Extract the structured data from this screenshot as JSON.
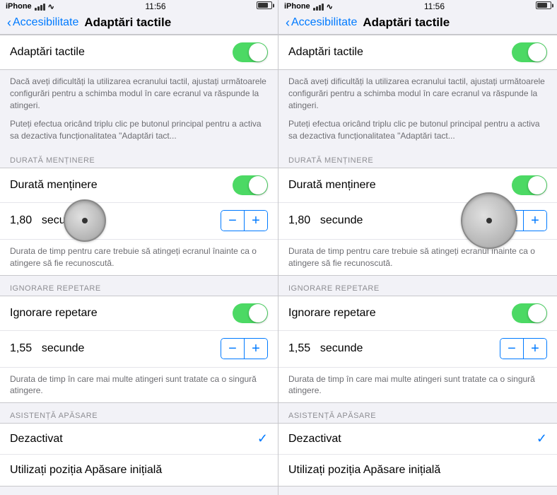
{
  "panels": [
    {
      "id": "left",
      "statusBar": {
        "carrier": "iPhone",
        "time": "11:56",
        "battery": true
      },
      "nav": {
        "backLabel": "Accesibilitate",
        "title": "Adaptări tactile"
      },
      "mainToggle": {
        "label": "Adaptări tactile",
        "on": true
      },
      "description1": "Dacă aveți dificultăți la utilizarea ecranului tactil, ajustați următoarele configurări pentru a schimba modul în care ecranul va răspunde la atingeri.",
      "description2": "Puteți efectua oricând triplu clic pe butonul principal pentru a activa sa dezactiva funcționalitatea \"Adaptări tact...",
      "sections": [
        {
          "header": "DURATĂ MENȚINERE",
          "rows": [
            {
              "type": "toggle-row",
              "label": "Durată menținere",
              "on": true
            },
            {
              "type": "value-stepper",
              "value": "1,80",
              "unit": "secunde",
              "showDial": true,
              "dialPosition": "center"
            },
            {
              "type": "description",
              "text": "Durata de timp pentru care trebuie să atingeți ecranul înainte ca o atingere să fie recunoscută."
            }
          ]
        },
        {
          "header": "IGNORARE REPETARE",
          "rows": [
            {
              "type": "toggle-row",
              "label": "Ignorare repetare",
              "on": true
            },
            {
              "type": "value-stepper",
              "value": "1,55",
              "unit": "secunde",
              "showDial": false
            },
            {
              "type": "description",
              "text": "Durata de timp în care mai multe atingeri sunt tratate ca o singură atingere."
            }
          ]
        },
        {
          "header": "ASISTENȚĂ APĂSARE",
          "rows": [
            {
              "type": "checkmark-row",
              "label": "Dezactivat",
              "checked": true
            },
            {
              "type": "plain-row",
              "label": "Utilizați poziția Apăsare inițială"
            }
          ]
        }
      ]
    },
    {
      "id": "right",
      "statusBar": {
        "carrier": "iPhone",
        "time": "11:56",
        "battery": true
      },
      "nav": {
        "backLabel": "Accesibilitate",
        "title": "Adaptări tactile"
      },
      "mainToggle": {
        "label": "Adaptări tactile",
        "on": true
      },
      "description1": "Dacă aveți dificultăți la utilizarea ecranului tactil, ajustați următoarele configurări pentru a schimba modul în care ecranul va răspunde la atingeri.",
      "description2": "Puteți efectua oricând triplu clic pe butonul principal pentru a activa sa dezactiva funcționalitatea \"Adaptări tact...",
      "sections": [
        {
          "header": "DURATĂ MENȚINERE",
          "rows": [
            {
              "type": "toggle-row",
              "label": "Durată menținere",
              "on": true
            },
            {
              "type": "value-stepper",
              "value": "1,80",
              "unit": "secunde",
              "showDial": true,
              "dialPosition": "right-overlap"
            },
            {
              "type": "description",
              "text": "Durata de timp pentru care trebuie să atingeți ecranul înainte ca o atingere să fie recunoscută."
            }
          ]
        },
        {
          "header": "IGNORARE REPETARE",
          "rows": [
            {
              "type": "toggle-row",
              "label": "Ignorare repetare",
              "on": true
            },
            {
              "type": "value-stepper",
              "value": "1,55",
              "unit": "secunde",
              "showDial": false
            },
            {
              "type": "description",
              "text": "Durata de timp în care mai multe atingeri sunt tratate ca o singură atingere."
            }
          ]
        },
        {
          "header": "ASISTENȚĂ APĂSARE",
          "rows": [
            {
              "type": "checkmark-row",
              "label": "Dezactivat",
              "checked": true
            },
            {
              "type": "plain-row",
              "label": "Utilizați poziția Apăsare inițială"
            }
          ]
        }
      ]
    }
  ],
  "icons": {
    "back": "‹",
    "check": "✓",
    "minus": "−",
    "plus": "+"
  }
}
